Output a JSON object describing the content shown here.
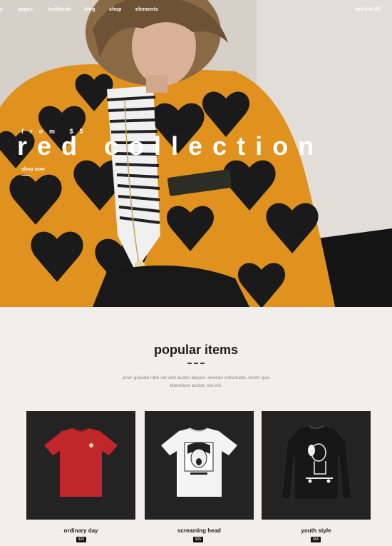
{
  "nav": {
    "items": [
      "pages",
      "lookbook",
      "blog",
      "shop",
      "elements"
    ],
    "wishlist": "wishlist (0)"
  },
  "hero": {
    "eyebrow": "from $5",
    "headline": "red collection",
    "cta": "shop now"
  },
  "popular": {
    "title": "popular items",
    "intro": "proin gravida nibh vel velit auctor aliquet. aenean sollicitudin, lorem quis bibendum auctor, nisi elit.",
    "products": [
      {
        "name": "ordinary day",
        "price": "$25",
        "icon": "red-tshirt"
      },
      {
        "name": "screaming head",
        "price": "$35",
        "icon": "white-print-tshirt"
      },
      {
        "name": "youth style",
        "price": "$55",
        "icon": "black-sweatshirt"
      }
    ]
  },
  "colors": {
    "jacket_orange": "#e0911e",
    "heart_black": "#1a1a1a",
    "card_bg": "#232323",
    "tee_red": "#c1262b"
  }
}
